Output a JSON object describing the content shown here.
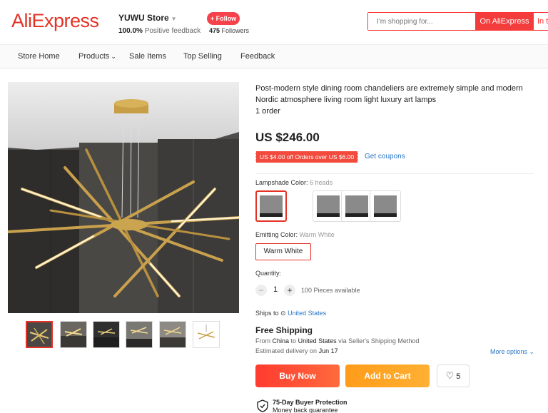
{
  "header": {
    "logo": "AliExpress",
    "store_name": "YUWU Store",
    "feedback_percent": "100.0%",
    "feedback_label": "Positive feedback",
    "follow_label": "+ Follow",
    "followers_count": "475",
    "followers_label": "Followers",
    "search_placeholder": "I'm shopping for...",
    "search_button": "On AliExpress",
    "search_button2": "In this store"
  },
  "nav": {
    "items": [
      "Store Home",
      "Products",
      "Sale Items",
      "Top Selling",
      "Feedback"
    ]
  },
  "product": {
    "title": "Post-modern style dining room chandeliers are extremely simple and modern Nordic atmosphere living room light luxury art lamps",
    "orders": "1 order",
    "price": "US $246.00",
    "coupon": "US $4.00 off Orders over US $6.00",
    "get_coupons": "Get coupons",
    "lampshade_label": "Lampshade Color:",
    "lampshade_value": "6 heads",
    "emitting_label": "Emitting Color:",
    "emitting_value": "Warm White",
    "emitting_option": "Warm White",
    "quantity_label": "Quantity:",
    "quantity_value": "1",
    "quantity_minus": "−",
    "quantity_plus": "+",
    "available": "100 Pieces available"
  },
  "shipping": {
    "ships_to_label": "Ships to",
    "ships_to_location": "United States",
    "free_shipping": "Free Shipping",
    "from_prefix": "From",
    "from_country": "China",
    "to_word": "to",
    "to_country": "United States",
    "method": "via Seller's Shipping Method",
    "est_label": "Estimated delivery on",
    "est_date": "Jun 17",
    "more_options": "More options"
  },
  "actions": {
    "buy_now": "Buy Now",
    "add_to_cart": "Add to Cart",
    "wishlist_count": "5"
  },
  "protection": {
    "title": "75-Day Buyer Protection",
    "subtitle": "Money back guarantee"
  },
  "colors": {
    "brand_red": "#e43225",
    "link_blue": "#2a76c6",
    "cart_orange": "#ff9c1a"
  }
}
